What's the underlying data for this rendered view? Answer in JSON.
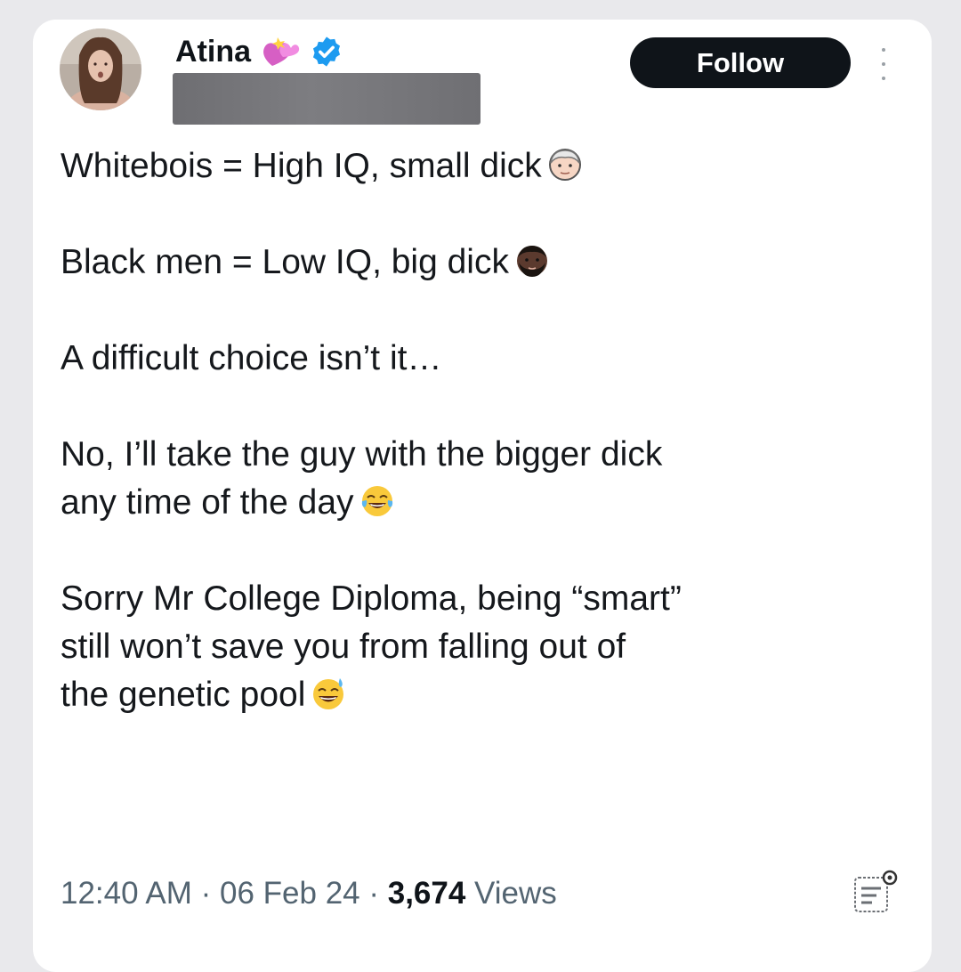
{
  "author": {
    "name": "Atina",
    "verified": true,
    "emoji": "heart-with-ribbon-icon"
  },
  "actions": {
    "follow_label": "Follow"
  },
  "tweet": {
    "paragraphs": [
      {
        "text": "Whitebois = High IQ, small dick",
        "emoji": "older-man-face-icon"
      },
      {
        "text": "Black men = Low IQ, big dick",
        "emoji": "bearded-man-face-icon"
      },
      {
        "text": "A difficult choice isn’t it…",
        "emoji": ""
      },
      {
        "text": "No, I’ll take the guy with the bigger dick\nany time of the day",
        "emoji": "tears-of-joy-icon"
      },
      {
        "text": "Sorry Mr College Diploma, being “smart”\nstill won’t save you from falling out of\nthe genetic pool",
        "emoji": "grinning-sweat-icon"
      }
    ]
  },
  "meta": {
    "time": "12:40 AM",
    "sep1": " · ",
    "date": "06 Feb 24",
    "sep2": " · ",
    "views_count": "3,674",
    "views_label": " Views"
  },
  "colors": {
    "accent_verified": "#1d9bf0",
    "follow_bg": "#0f1419",
    "meta_text": "#536471"
  }
}
